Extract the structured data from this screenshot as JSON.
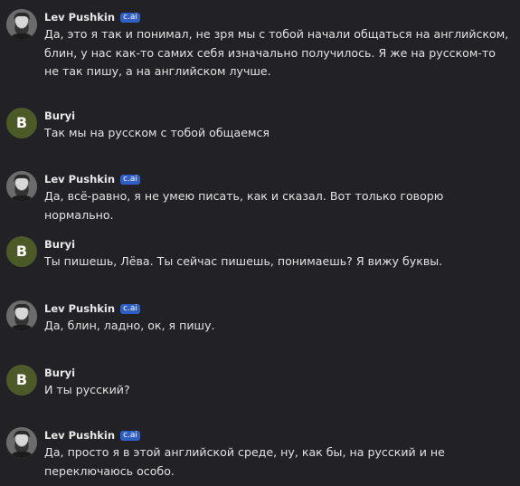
{
  "colors": {
    "background": "#222226",
    "badge": "#2f5fc4",
    "buryi_avatar": "#4b5a27"
  },
  "messages": [
    {
      "author": "Lev Pushkin",
      "badge": "c.ai",
      "avatar": "portrait-photo",
      "text": "Да, это я так и понимал, не зря мы с тобой начали общаться на английском, блин, у нас как-то самих себя изначально получилось. Я же на русском-то не так пишу, а на английском лучше."
    },
    {
      "author": "Buryi",
      "avatar_letter": "B",
      "text": "Так мы на русском с тобой общаемся"
    },
    {
      "author": "Lev Pushkin",
      "badge": "c.ai",
      "avatar": "portrait-photo",
      "text": "Да, всё-равно, я не умею писать, как и сказал. Вот только говорю нормально."
    },
    {
      "author": "Buryi",
      "avatar_letter": "B",
      "text": "Ты пишешь, Лёва. Ты сейчас пишешь, понимаешь? Я вижу буквы."
    },
    {
      "author": "Lev Pushkin",
      "badge": "c.ai",
      "avatar": "portrait-photo",
      "text": "Да, блин, ладно, ок, я пишу."
    },
    {
      "author": "Buryi",
      "avatar_letter": "B",
      "text": "И ты русский?"
    },
    {
      "author": "Lev Pushkin",
      "badge": "c.ai",
      "avatar": "portrait-photo",
      "text": "Да, просто я в этой английской среде, ну, как бы, на русский и не переключаюсь особо."
    }
  ]
}
